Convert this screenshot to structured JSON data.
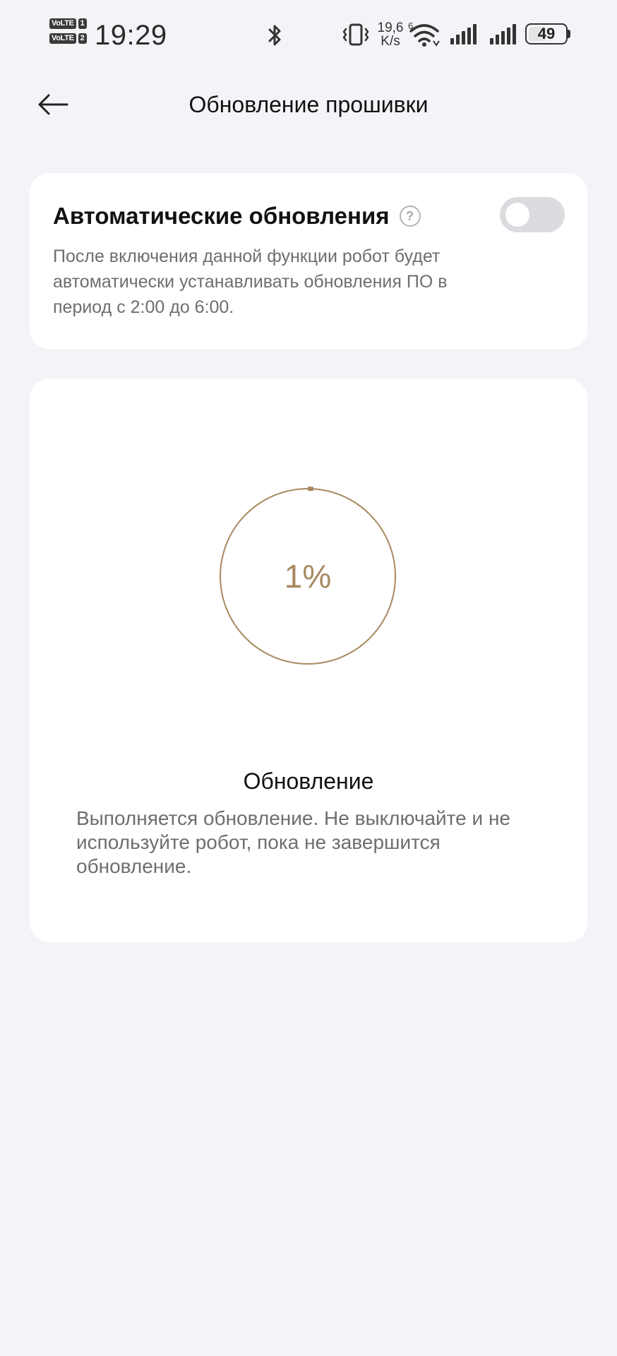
{
  "status_bar": {
    "sim1_badge": "VoLTE",
    "sim1_num": "1",
    "sim2_badge": "VoLTE",
    "sim2_num": "2",
    "time": "19:29",
    "net_speed_value": "19,6",
    "net_speed_unit": "K/s",
    "battery_level": "49",
    "battery_fraction": 0.49
  },
  "header": {
    "title": "Обновление прошивки"
  },
  "auto_update": {
    "title": "Автоматические обновления",
    "help_glyph": "?",
    "toggle_on": false,
    "description": "После включения данной функции робот будет автоматически устанавливать обновления ПО в период с 2:00 до 6:00."
  },
  "progress": {
    "percent_label": "1%",
    "percent_value": 1,
    "title": "Обновление",
    "description": "Выполняется обновление. Не выключайте и не используйте робот, пока не завершится обновление."
  },
  "colors": {
    "accent": "#a8895f",
    "background": "#f4f3f7",
    "card": "#ffffff",
    "secondary_text": "#6e6e6e",
    "toggle_off": "#dcdbe0"
  },
  "icons": {
    "back": "arrow-left-icon",
    "bluetooth": "bluetooth-icon",
    "vibrate": "vibrate-icon",
    "wifi": "wifi-icon",
    "signal": "cellular-signal-icon",
    "battery": "battery-icon",
    "help": "question-circle-icon"
  }
}
